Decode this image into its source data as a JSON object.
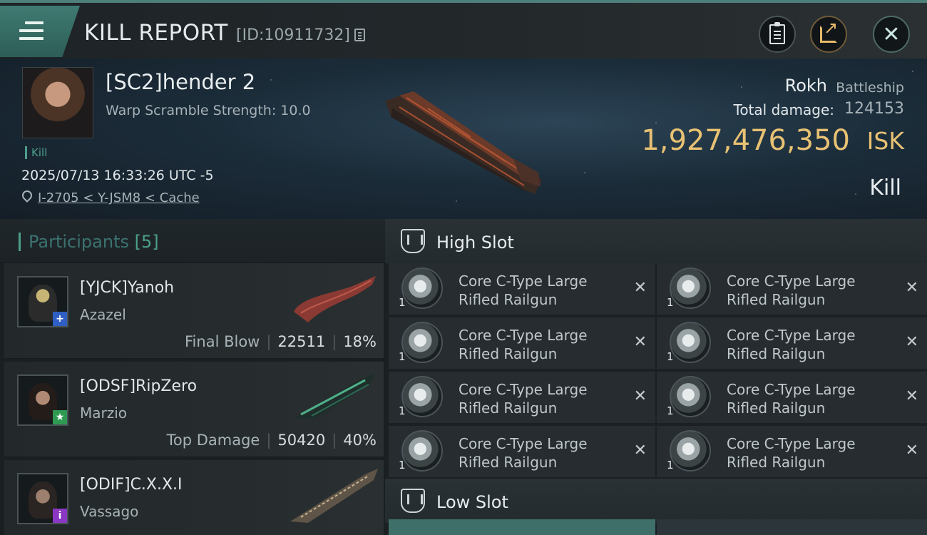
{
  "header": {
    "title": "KILL REPORT",
    "report_id": "[ID:10911732]",
    "buttons": [
      "clipboard-icon",
      "share-icon",
      "close-icon"
    ]
  },
  "victim": {
    "name": "[SC2]hender 2",
    "warp_scramble": "Warp Scramble Strength: 10.0",
    "tag": "Kill",
    "datetime": "2025/07/13 16:33:26 UTC -5",
    "location": "I-2705 < Y-JSM8 < Cache",
    "ship_name": "Rokh",
    "ship_class": "Battleship",
    "total_damage_label": "Total damage:",
    "total_damage": "124153",
    "isk_value": "1,927,476,350",
    "isk_unit": "ISK",
    "kill_type": "Kill"
  },
  "participants": {
    "title": "Participants",
    "count": "[5]",
    "rows": [
      {
        "name": "[YJCK]Yanoh",
        "ship": "Azazel",
        "role": "Final Blow",
        "damage": "22511",
        "percent": "18%",
        "badge": "+",
        "badge_color": "#2f5fc4"
      },
      {
        "name": "[ODSF]RipZero",
        "ship": "Marzio",
        "role": "Top Damage",
        "damage": "50420",
        "percent": "40%",
        "badge": "★",
        "badge_color": "#2e9a52"
      },
      {
        "name": "[ODIF]C.X.X.I",
        "ship": "Vassago",
        "role": "",
        "damage": "",
        "percent": "",
        "badge": "i",
        "badge_color": "#8a37c4"
      }
    ]
  },
  "fittings": {
    "high_slot_title": "High Slot",
    "low_slot_title": "Low Slot",
    "high_slots": [
      {
        "line1": "Core C-Type Large",
        "line2": "Rifled Railgun",
        "qty": "1"
      },
      {
        "line1": "Core C-Type Large",
        "line2": "Rifled Railgun",
        "qty": "1"
      },
      {
        "line1": "Core C-Type Large",
        "line2": "Rifled Railgun",
        "qty": "1"
      },
      {
        "line1": "Core C-Type Large",
        "line2": "Rifled Railgun",
        "qty": "1"
      },
      {
        "line1": "Core C-Type Large",
        "line2": "Rifled Railgun",
        "qty": "1"
      },
      {
        "line1": "Core C-Type Large",
        "line2": "Rifled Railgun",
        "qty": "1"
      },
      {
        "line1": "Core C-Type Large",
        "line2": "Rifled Railgun",
        "qty": "1"
      },
      {
        "line1": "Core C-Type Large",
        "line2": "Rifled Railgun",
        "qty": "1"
      }
    ],
    "remove_glyph": "✕"
  },
  "colors": {
    "accent": "#4c9f8c",
    "isk": "#e8c173",
    "menu_button": "#3f7b72"
  }
}
